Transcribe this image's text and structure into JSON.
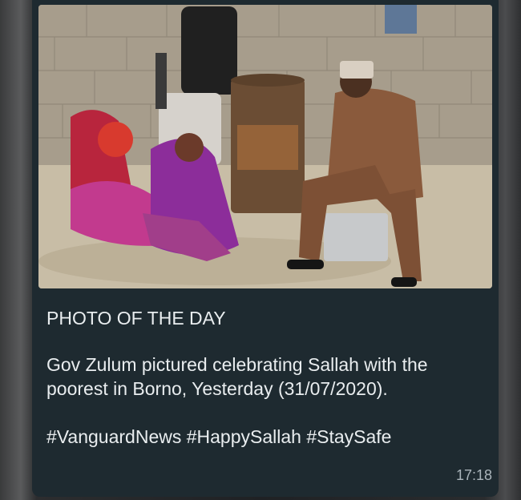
{
  "message": {
    "heading": "PHOTO OF THE DAY",
    "body_line1": "Gov Zulum pictured celebrating Sallah with the",
    "body_line2": "poorest in Borno, Yesterday (31/07/2020).",
    "hashtags": "#VanguardNews #HappySallah #StaySafe",
    "time": "17:18"
  },
  "photo": {
    "alt": "Governor in brown outfit and cap seated on a block beside women in pink and purple wrappers, a barrel and a man standing by a brick wall"
  },
  "colors": {
    "bubble": "#1e2a30",
    "text": "#e9edef",
    "time": "#aab4ba"
  }
}
